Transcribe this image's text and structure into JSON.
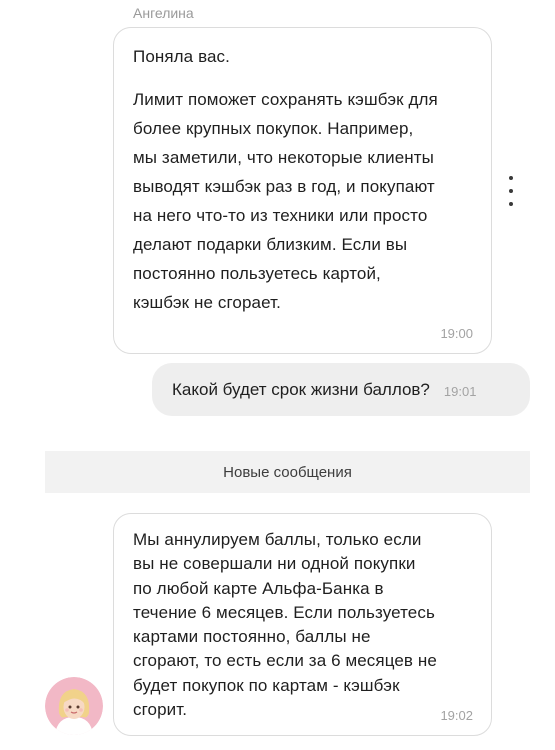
{
  "chat": {
    "sender_name": "Ангелина",
    "msg1": {
      "para1": "Поняла вас.",
      "para2": "Лимит поможет сохранять кэшбэк для\nболее крупных покупок. Например,\nмы заметили, что некоторые клиенты\nвыводят кэшбэк раз в год, и покупают\nна него что-то из техники или просто\nделают подарки близким. Если вы\nпостоянно пользуетесь картой,\nкэшбэк не сгорает.",
      "time": "19:00"
    },
    "msg2": {
      "text": "Какой будет срок жизни баллов?",
      "time": "19:01"
    },
    "divider": "Новые сообщения",
    "msg3": {
      "text": "Мы аннулируем баллы, только если\nвы не совершали ни одной покупки\nпо любой карте Альфа-Банка в\nтечение 6 месяцев. Если пользуетесь\nкартами постоянно, баллы не\nсгорают, то есть если за 6 месяцев не\nбудет покупок по картам - кэшбэк\nсгорит.",
      "time": "19:02"
    }
  },
  "icons": {
    "more": "more-vertical-icon",
    "avatar": "assistant-avatar"
  }
}
